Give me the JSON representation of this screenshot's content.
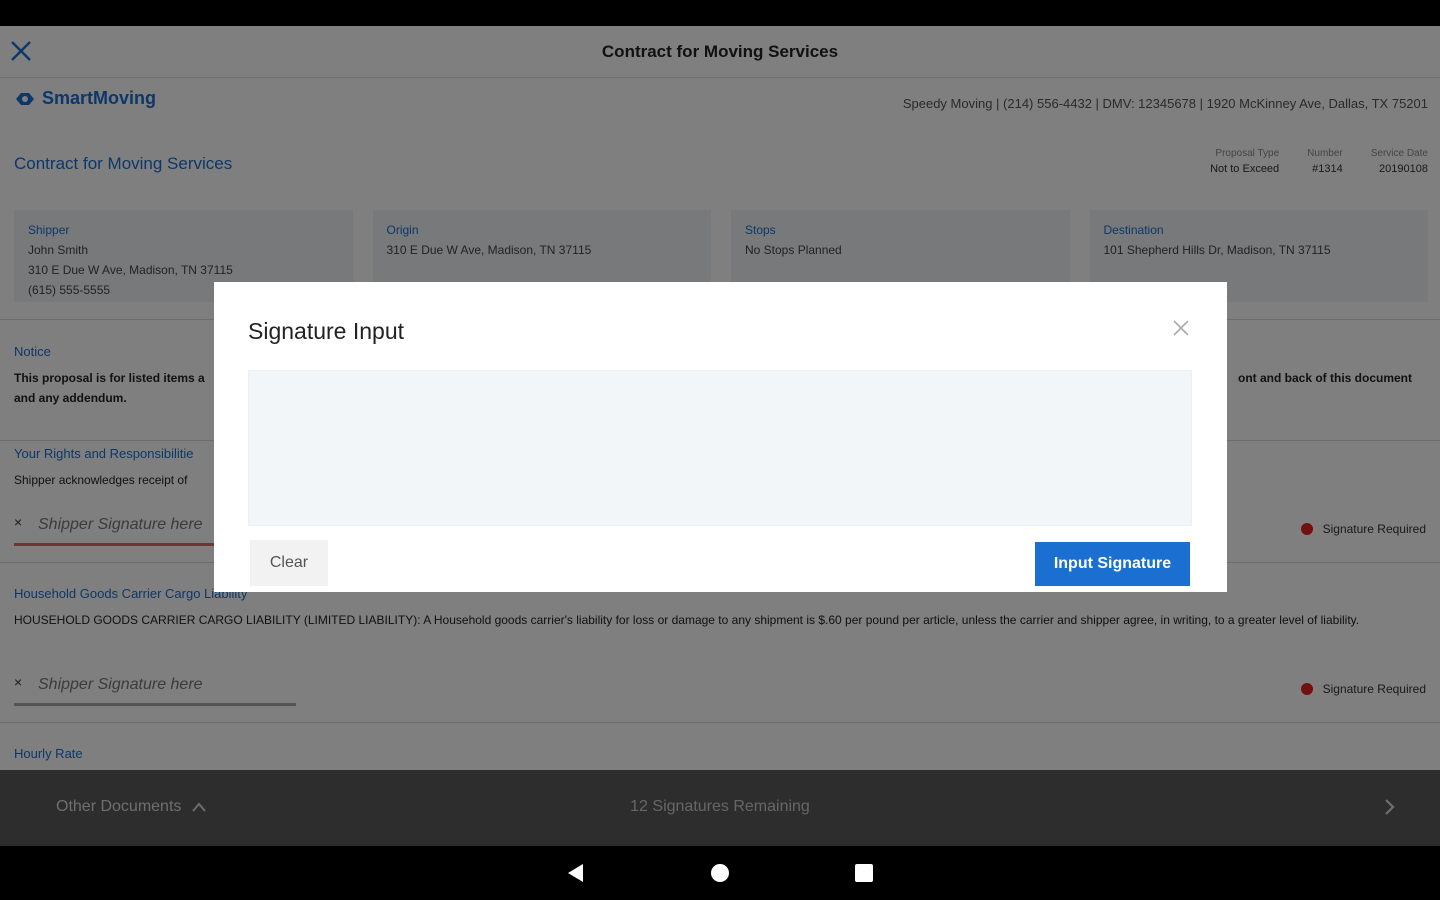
{
  "appbar": {
    "title": "Contract for Moving Services"
  },
  "brand": {
    "name": "SmartMoving"
  },
  "company_line": "Speedy Moving | (214) 556-4432 | DMV: 12345678 | 1920 McKinney Ave, Dallas, TX 75201",
  "document": {
    "title": "Contract for Moving Services",
    "meta": [
      {
        "label": "Proposal Type",
        "value": "Not to Exceed"
      },
      {
        "label": "Number",
        "value": "#1314"
      },
      {
        "label": "Service Date",
        "value": "20190108"
      }
    ]
  },
  "cards": [
    {
      "label": "Shipper",
      "lines": [
        "John Smith",
        "310 E Due W Ave, Madison, TN 37115",
        "(615) 555-5555"
      ]
    },
    {
      "label": "Origin",
      "lines": [
        "310 E Due W Ave, Madison, TN 37115"
      ]
    },
    {
      "label": "Stops",
      "lines": [
        "No Stops Planned"
      ]
    },
    {
      "label": "Destination",
      "lines": [
        "101 Shepherd Hills Dr, Madison, TN 37115"
      ]
    }
  ],
  "sections": {
    "notice": {
      "title": "Notice",
      "text_left": "This proposal is for listed items a",
      "text_right": "ont and back of this document",
      "text_line2": "and any addendum."
    },
    "rights": {
      "title": "Your Rights and Responsibilitie",
      "text": "Shipper acknowledges receipt of ",
      "signature_placeholder": "Shipper Signature here",
      "signature_required": "Signature Required"
    },
    "cargo": {
      "title": "Household Goods Carrier Cargo Liability",
      "text": "HOUSEHOLD GOODS CARRIER CARGO LIABILITY (LIMITED LIABILITY): A Household goods carrier's liability for loss or damage to any shipment is $.60 per pound per article, unless the carrier and shipper agree, in writing, to a greater level of liability.",
      "signature_placeholder": "Shipper Signature here",
      "signature_required": "Signature Required"
    },
    "hourly": {
      "title": "Hourly Rate"
    }
  },
  "modal": {
    "title": "Signature Input",
    "clear_label": "Clear",
    "submit_label": "Input Signature"
  },
  "bottombar": {
    "other_documents": "Other Documents",
    "remaining": "12 Signatures Remaining"
  },
  "colors": {
    "accent": "#1a6fd1",
    "required": "#e02020"
  }
}
